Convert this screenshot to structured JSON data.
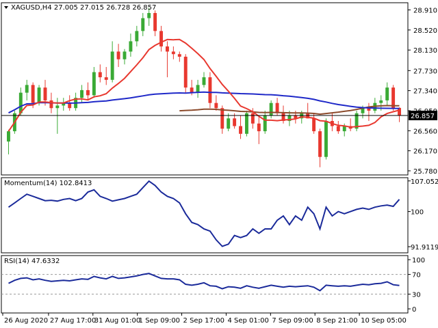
{
  "chart_data": {
    "type": "candlestick",
    "symbol_line": "XAGUSD,H4  27.005 27.015 26.728 26.857",
    "current_price": "26.857",
    "colors": {
      "bull": "#3aaa35",
      "bear": "#e8382f",
      "sma_fast": "#e8382f",
      "sma_mid": "#1e28c8",
      "sma_slow": "#8b4a2b",
      "indicator": "#1a2a9a",
      "price_line": "#000000"
    },
    "price_axis": {
      "ylim": [
        25.7,
        29.05
      ],
      "ticks": [
        "28.910",
        "28.520",
        "28.130",
        "27.730",
        "27.340",
        "26.950",
        "26.560",
        "26.170",
        "25.780"
      ]
    },
    "x_ticks": [
      "26 Aug 2020",
      "27 Aug 17:00",
      "31 Aug 01:00",
      "1 Sep 09:00",
      "2 Sep 17:00",
      "4 Sep 01:00",
      "7 Sep 09:00",
      "8 Sep 21:00",
      "10 Sep 05:00"
    ],
    "candles": [
      [
        26.35,
        26.58,
        26.1,
        26.55
      ],
      [
        26.55,
        26.95,
        26.5,
        26.9
      ],
      [
        26.9,
        27.4,
        26.85,
        27.3
      ],
      [
        27.3,
        27.55,
        27.15,
        27.45
      ],
      [
        27.45,
        27.5,
        27.0,
        27.1
      ],
      [
        27.1,
        27.45,
        27.05,
        27.4
      ],
      [
        27.4,
        27.55,
        27.05,
        27.15
      ],
      [
        27.15,
        27.3,
        26.9,
        27.0
      ],
      [
        27.0,
        27.2,
        26.5,
        27.05
      ],
      [
        27.05,
        27.2,
        26.95,
        27.1
      ],
      [
        27.1,
        27.25,
        26.95,
        27.0
      ],
      [
        27.0,
        27.3,
        26.95,
        27.2
      ],
      [
        27.2,
        27.45,
        27.1,
        27.35
      ],
      [
        27.35,
        27.5,
        27.15,
        27.25
      ],
      [
        27.25,
        27.8,
        27.2,
        27.7
      ],
      [
        27.7,
        27.85,
        27.5,
        27.6
      ],
      [
        27.6,
        27.8,
        27.45,
        27.55
      ],
      [
        27.55,
        28.3,
        27.5,
        28.1
      ],
      [
        28.1,
        28.25,
        27.8,
        27.95
      ],
      [
        27.95,
        28.15,
        27.85,
        28.1
      ],
      [
        28.1,
        28.45,
        28.0,
        28.3
      ],
      [
        28.3,
        28.6,
        28.2,
        28.5
      ],
      [
        28.5,
        28.85,
        28.4,
        28.75
      ],
      [
        28.75,
        28.95,
        28.6,
        28.85
      ],
      [
        28.85,
        28.9,
        28.4,
        28.5
      ],
      [
        28.5,
        28.6,
        28.1,
        28.2
      ],
      [
        28.2,
        28.3,
        27.6,
        28.1
      ],
      [
        28.1,
        28.2,
        27.95,
        28.05
      ],
      [
        28.05,
        28.1,
        27.9,
        28.0
      ],
      [
        28.0,
        28.05,
        27.3,
        27.4
      ],
      [
        27.4,
        27.55,
        27.25,
        27.3
      ],
      [
        27.3,
        27.55,
        27.2,
        27.45
      ],
      [
        27.45,
        27.7,
        27.4,
        27.6
      ],
      [
        27.6,
        27.7,
        27.0,
        27.1
      ],
      [
        27.1,
        27.25,
        26.95,
        27.0
      ],
      [
        27.0,
        27.05,
        26.5,
        26.6
      ],
      [
        26.6,
        26.9,
        26.55,
        26.8
      ],
      [
        26.8,
        26.9,
        26.6,
        26.65
      ],
      [
        26.65,
        26.85,
        26.4,
        26.5
      ],
      [
        26.5,
        26.95,
        26.45,
        26.9
      ],
      [
        26.9,
        27.0,
        26.6,
        26.7
      ],
      [
        26.7,
        26.85,
        26.3,
        26.55
      ],
      [
        26.55,
        26.95,
        26.5,
        26.85
      ],
      [
        26.85,
        27.15,
        26.8,
        27.1
      ],
      [
        27.1,
        27.2,
        26.85,
        26.9
      ],
      [
        26.9,
        27.05,
        26.7,
        26.75
      ],
      [
        26.75,
        26.95,
        26.65,
        26.85
      ],
      [
        26.85,
        26.95,
        26.7,
        26.8
      ],
      [
        26.8,
        26.95,
        26.7,
        26.9
      ],
      [
        26.9,
        27.1,
        26.8,
        26.8
      ],
      [
        26.8,
        26.9,
        26.5,
        26.55
      ],
      [
        26.55,
        26.6,
        25.85,
        26.05
      ],
      [
        26.05,
        26.8,
        26.0,
        26.75
      ],
      [
        26.75,
        26.9,
        26.55,
        26.65
      ],
      [
        26.65,
        26.75,
        26.5,
        26.55
      ],
      [
        26.55,
        26.7,
        26.45,
        26.65
      ],
      [
        26.65,
        26.8,
        26.55,
        26.6
      ],
      [
        26.6,
        26.95,
        26.55,
        26.9
      ],
      [
        26.9,
        27.05,
        26.8,
        27.0
      ],
      [
        27.0,
        27.1,
        26.75,
        26.95
      ],
      [
        26.95,
        27.2,
        26.9,
        27.1
      ],
      [
        27.1,
        27.25,
        26.95,
        27.15
      ],
      [
        27.15,
        27.5,
        27.05,
        27.4
      ],
      [
        27.4,
        27.45,
        26.95,
        27.0
      ],
      [
        27.005,
        27.015,
        26.728,
        26.857
      ]
    ],
    "momentum": {
      "label": "Momentum(14) 102.8413",
      "ylim": [
        90.5,
        107.8
      ],
      "ticks": [
        "107.0522",
        "100",
        "91.9119"
      ],
      "values": [
        101,
        102,
        103,
        104,
        103.5,
        103,
        102.5,
        102.6,
        102.4,
        102.8,
        103,
        102.5,
        103,
        104.5,
        105,
        103.5,
        103,
        102.4,
        102.7,
        103,
        103.5,
        104,
        105.5,
        107,
        106,
        104.5,
        103.5,
        103,
        102,
        99.5,
        97.5,
        97,
        96,
        95.5,
        93.5,
        92,
        92.5,
        94.5,
        94,
        94.5,
        96,
        95,
        96,
        96,
        98,
        99,
        97,
        99,
        98,
        101,
        99.5,
        96,
        101,
        99,
        100,
        99.5,
        100,
        100.5,
        100.8,
        100.5,
        101,
        101.3,
        101.5,
        101.2,
        102.8
      ]
    },
    "rsi": {
      "label": "RSI(14) 47.6332",
      "ylim": [
        0,
        100
      ],
      "ticks": [
        "100",
        "70",
        "30",
        "0"
      ],
      "levels": [
        70,
        30
      ],
      "values": [
        52,
        58,
        62,
        63,
        59,
        61,
        58,
        56,
        57,
        58,
        57,
        59,
        61,
        60,
        66,
        63,
        61,
        66,
        62,
        63,
        65,
        67,
        70,
        72,
        67,
        62,
        61,
        61,
        59,
        50,
        48,
        50,
        53,
        47,
        46,
        41,
        45,
        44,
        42,
        47,
        44,
        42,
        45,
        48,
        46,
        44,
        46,
        45,
        46,
        47,
        44,
        37,
        48,
        47,
        46,
        47,
        46,
        48,
        50,
        49,
        51,
        52,
        55,
        49,
        47.6
      ]
    }
  }
}
